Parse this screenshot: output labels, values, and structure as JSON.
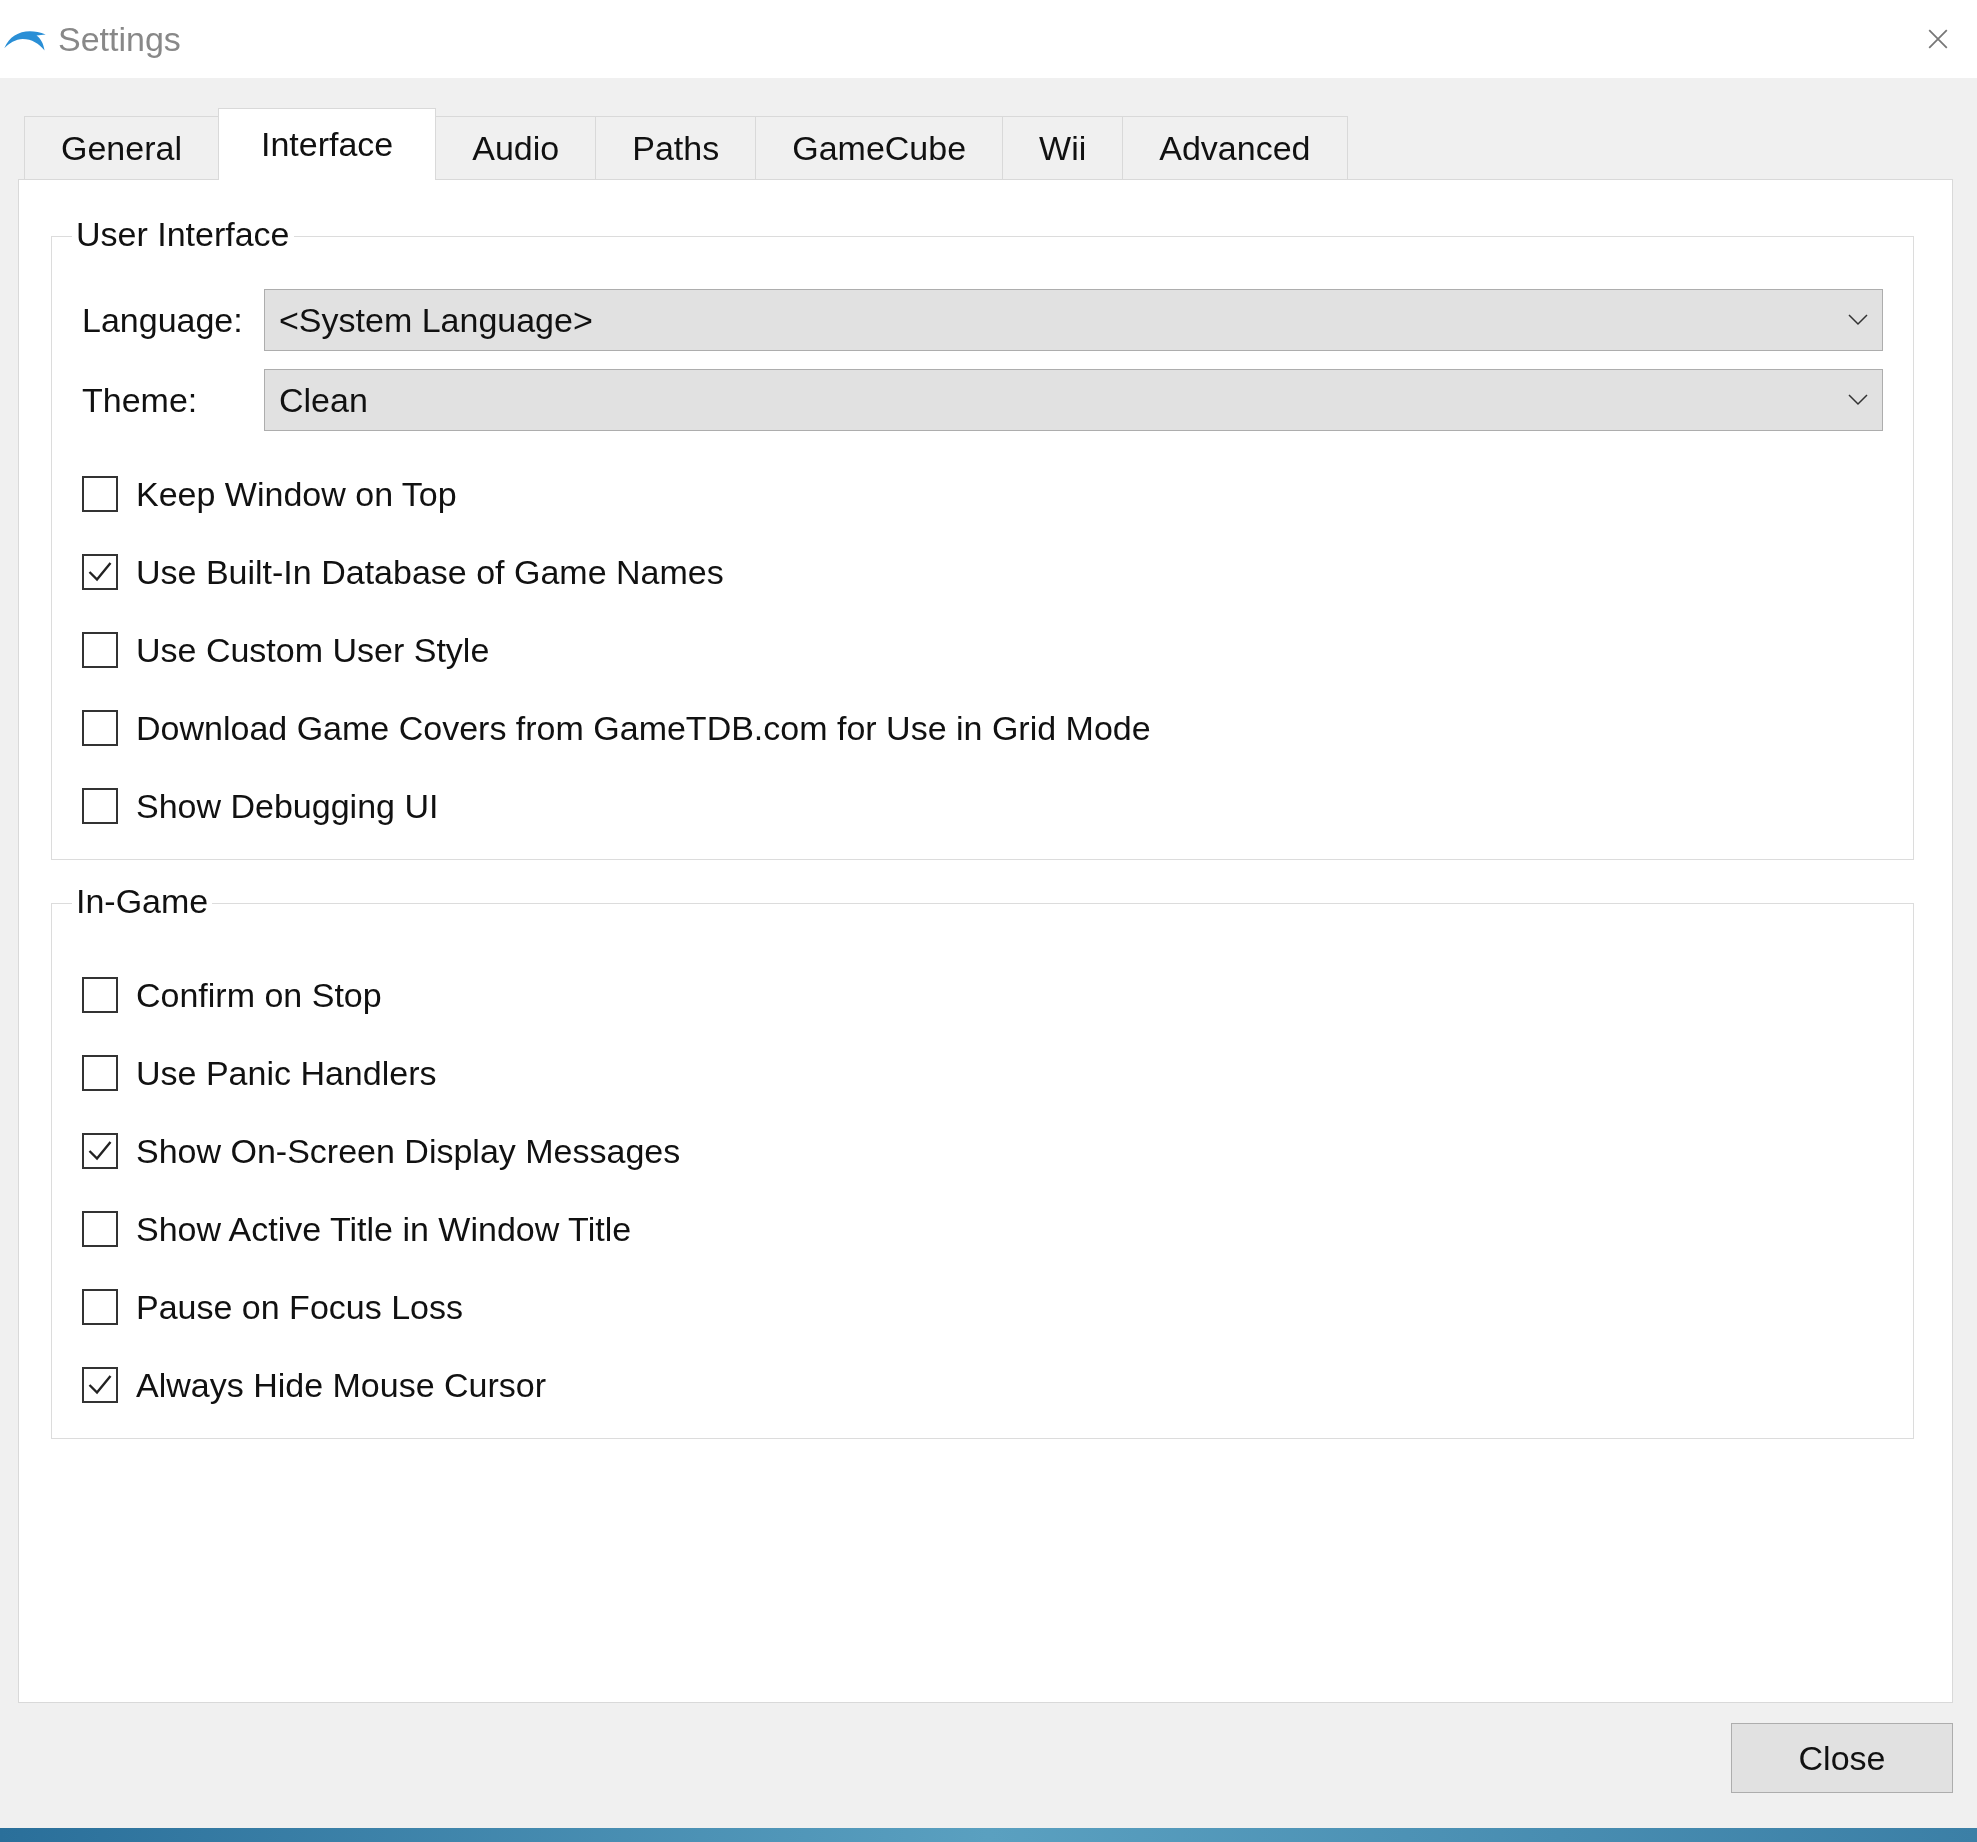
{
  "window": {
    "title": "Settings"
  },
  "tabs": [
    {
      "label": "General",
      "selected": false
    },
    {
      "label": "Interface",
      "selected": true
    },
    {
      "label": "Audio",
      "selected": false
    },
    {
      "label": "Paths",
      "selected": false
    },
    {
      "label": "GameCube",
      "selected": false
    },
    {
      "label": "Wii",
      "selected": false
    },
    {
      "label": "Advanced",
      "selected": false
    }
  ],
  "groups": [
    {
      "title": "User Interface",
      "fields": [
        {
          "label": "Language:",
          "value": "<System Language>"
        },
        {
          "label": "Theme:",
          "value": "Clean"
        }
      ],
      "options": [
        {
          "label": "Keep Window on Top",
          "checked": false
        },
        {
          "label": "Use Built-In Database of Game Names",
          "checked": true
        },
        {
          "label": "Use Custom User Style",
          "checked": false
        },
        {
          "label": "Download Game Covers from GameTDB.com for Use in Grid Mode",
          "checked": false
        },
        {
          "label": "Show Debugging UI",
          "checked": false
        }
      ]
    },
    {
      "title": "In-Game",
      "options": [
        {
          "label": "Confirm on Stop",
          "checked": false
        },
        {
          "label": "Use Panic Handlers",
          "checked": false
        },
        {
          "label": "Show On-Screen Display Messages",
          "checked": true
        },
        {
          "label": "Show Active Title in Window Title",
          "checked": false
        },
        {
          "label": "Pause on Focus Loss",
          "checked": false
        },
        {
          "label": "Always Hide Mouse Cursor",
          "checked": true
        }
      ]
    }
  ],
  "buttons": [
    "Close"
  ]
}
